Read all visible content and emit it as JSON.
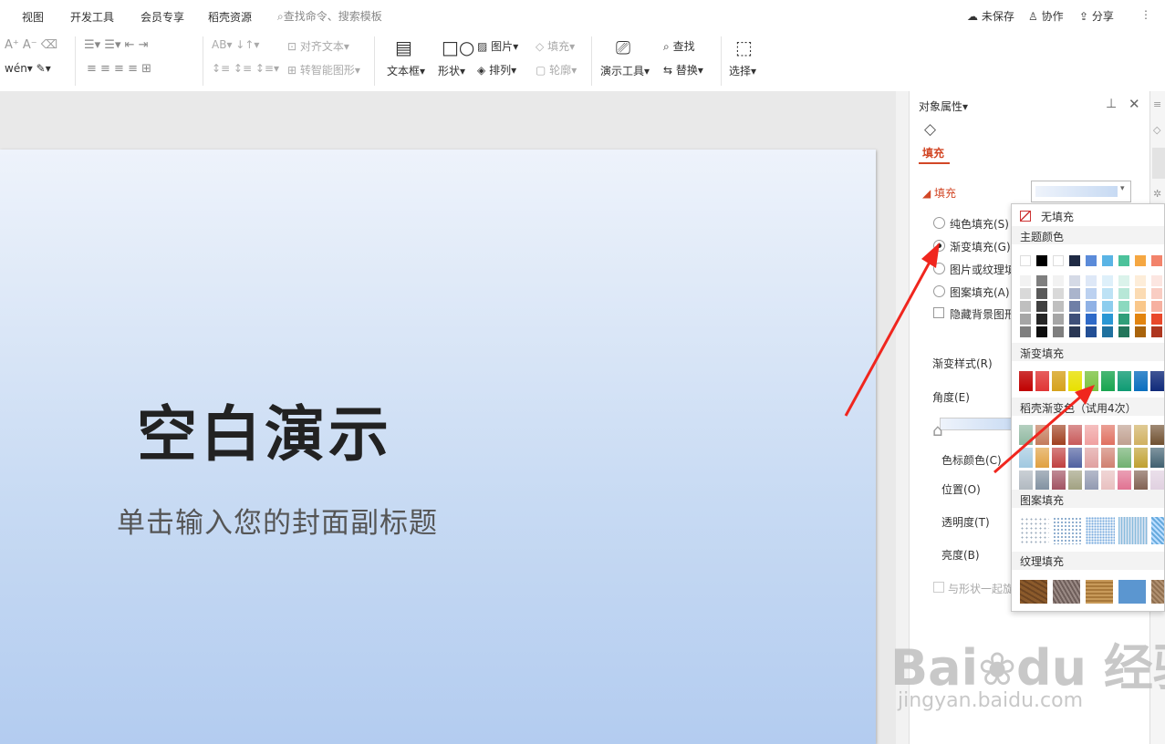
{
  "menu": {
    "items": [
      "视图",
      "开发工具",
      "会员专享",
      "稻壳资源"
    ],
    "search_placeholder": "查找命令、搜索模板",
    "unsaved": "未保存",
    "collab": "协作",
    "share": "分享"
  },
  "toolbar": {
    "align_text": "对齐文本",
    "smart_shape": "转智能图形",
    "textbox": "文本框",
    "shape": "形状",
    "picture": "图片",
    "arrange": "排列",
    "fill": "填充",
    "outline": "轮廓",
    "present_tools": "演示工具",
    "find": "查找",
    "replace": "替换",
    "select": "选择"
  },
  "slide": {
    "title": "空白演示",
    "subtitle": "单击输入您的封面副标题"
  },
  "panel": {
    "header": "对象属性",
    "tab_fill": "填充",
    "section_fill": "填充",
    "opt_solid": "纯色填充(S)",
    "opt_gradient": "渐变填充(G)",
    "opt_picture": "图片或纹理填",
    "opt_pattern": "图案填充(A)",
    "opt_hide_bg": "隐藏背景图形",
    "gradient_style": "渐变样式(R)",
    "angle": "角度(E)",
    "stop_color": "色标颜色(C)",
    "position": "位置(O)",
    "transparency": "透明度(T)",
    "brightness": "亮度(B)",
    "rotate_with_shape": "与形状一起旋",
    "selected_option": "渐变填充(G)"
  },
  "popup": {
    "no_fill": "无填充",
    "theme_colors": "主题颜色",
    "gradient_fill": "渐变填充",
    "docer_gradient": "稻壳渐变色（试用4次）",
    "pattern_fill": "图案填充",
    "texture_fill": "纹理填充"
  },
  "colors": {
    "theme_top": [
      "#ffffff",
      "#000000",
      "#ffffff",
      "#1f2a44",
      "#5b8bd9",
      "#5ab4e5",
      "#4cc29b",
      "#f5a742",
      "#f2836b"
    ],
    "theme_cols": [
      [
        "#f2f2f2",
        "#d9d9d9",
        "#bfbfbf",
        "#a6a6a6",
        "#7f7f7f"
      ],
      [
        "#7f7f7f",
        "#595959",
        "#404040",
        "#262626",
        "#0d0d0d"
      ],
      [
        "#f2f2f2",
        "#d9d9d9",
        "#bfbfbf",
        "#a6a6a6",
        "#7f7f7f"
      ],
      [
        "#d5dae6",
        "#aab4cc",
        "#6f7fa6",
        "#3e4f79",
        "#2a3754"
      ],
      [
        "#dee8f7",
        "#bcd1f0",
        "#8fb1e5",
        "#2f6ac8",
        "#234f95"
      ],
      [
        "#def0fa",
        "#bde2f5",
        "#8dcdee",
        "#2a97d4",
        "#1f719f"
      ],
      [
        "#dbf3eb",
        "#b7e7d7",
        "#8bd9bf",
        "#2f9e79",
        "#23765b"
      ],
      [
        "#fdedd9",
        "#fbdbb3",
        "#f9c78a",
        "#e2840f",
        "#a9630b"
      ],
      [
        "#fce6e1",
        "#f9cdc3",
        "#f6b0a0",
        "#e9482a",
        "#ae361f"
      ]
    ],
    "gradients": [
      "#c00000",
      "#e03535",
      "#d6a21c",
      "#e8e000",
      "#7cc242",
      "#19a550",
      "#0f9b73",
      "#0b6fbf",
      "#102a7a"
    ],
    "docer": [
      [
        "#8fb8a0",
        "#c47a5a",
        "#a04020",
        "#c85a5a",
        "#f0a0a0",
        "#e07060",
        "#c0a090",
        "#d0b060",
        "#705030"
      ],
      [
        "#a0c8e0",
        "#e0a040",
        "#c04040",
        "#5060a0",
        "#e0a0a0",
        "#d08070",
        "#70b070",
        "#c0a030",
        "#406070"
      ],
      [
        "#b0b8c0",
        "#8090a0",
        "#a05060",
        "#a0a080",
        "#9098b0",
        "#e8c0c0",
        "#e07090",
        "#806050",
        "#e0d0e0"
      ]
    ]
  }
}
